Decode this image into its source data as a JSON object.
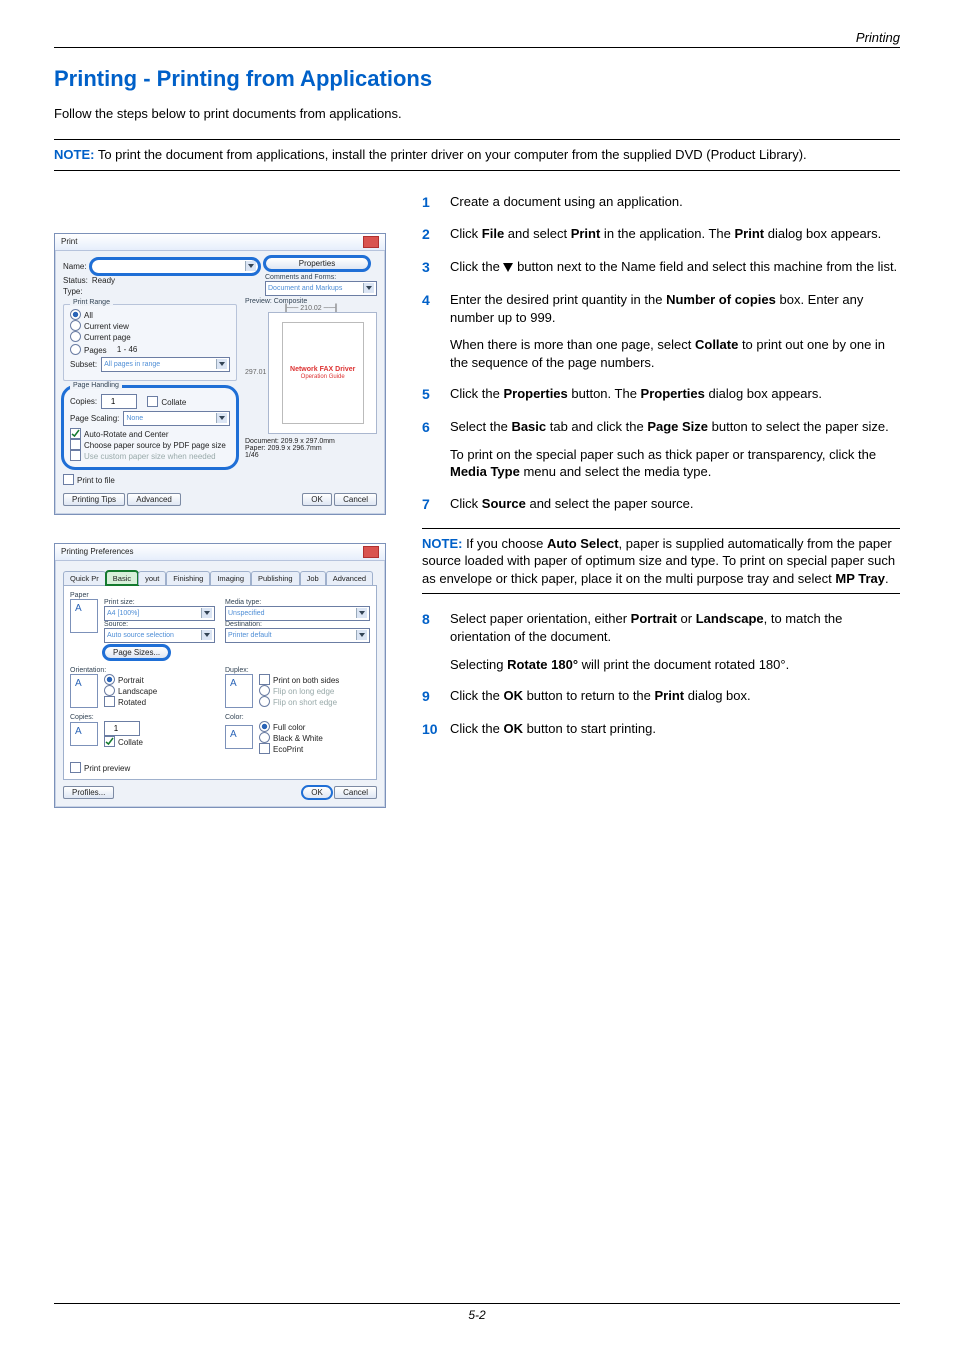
{
  "header": {
    "section": "Printing"
  },
  "title": "Printing - Printing from Applications",
  "intro": "Follow the steps below to print documents from applications.",
  "note1": {
    "label": "NOTE:",
    "text": "To print the document from applications, install the printer driver on your computer from the supplied DVD (Product Library)."
  },
  "steps": [
    {
      "n": "1",
      "paras": [
        "Create a document using an application."
      ]
    },
    {
      "n": "2",
      "paras": [
        "Click <b>File</b> and select <b>Print</b> in the application. The <b>Print</b> dialog box appears."
      ]
    },
    {
      "n": "3",
      "paras": [
        "Click the ▼ button next to the Name field and select this machine from the list."
      ],
      "triangle": true
    },
    {
      "n": "4",
      "paras": [
        "Enter the desired print quantity in the <b>Number of copies</b> box. Enter any number up to 999.",
        "When there is more than one page, select <b>Collate</b> to print out one by one in the sequence of the page numbers."
      ]
    },
    {
      "n": "5",
      "paras": [
        "Click the <b>Properties</b> button. The <b>Properties</b> dialog box appears."
      ]
    },
    {
      "n": "6",
      "paras": [
        "Select the <b>Basic</b> tab and click the <b>Page Size</b> button to select the paper size.",
        "To print on the special paper such as thick paper or transparency, click the <b>Media Type</b> menu and select the media type."
      ]
    },
    {
      "n": "7",
      "paras": [
        "Click <b>Source</b> and select the paper source."
      ]
    }
  ],
  "note2": {
    "label": "NOTE:",
    "text": "If you choose <b>Auto Select</b>, paper is supplied automatically from the paper source loaded with paper of optimum size and type. To print on special paper such as envelope or thick paper, place it on the multi purpose tray and select <b>MP Tray</b>."
  },
  "steps_after": [
    {
      "n": "8",
      "paras": [
        "Select paper orientation, either <b>Portrait</b> or <b>Landscape</b>, to match the orientation of the document.",
        "Selecting <b>Rotate 180°</b> will print the document rotated 180°."
      ]
    },
    {
      "n": "9",
      "paras": [
        "Click the <b>OK</b> button to return to the <b>Print</b> dialog box."
      ]
    },
    {
      "n": "10",
      "paras": [
        "Click the <b>OK</b> button to start printing."
      ]
    }
  ],
  "footer": "5-2",
  "dlg1": {
    "title": "Print",
    "name_label": "Name:",
    "properties_btn": "Properties",
    "status_label": "Status:",
    "status_value": "Ready",
    "type_label": "Type:",
    "comments_label": "Comments and Forms:",
    "comments_value": "Document and Markups",
    "range_title": "Print Range",
    "all": "All",
    "current_view": "Current view",
    "current_page": "Current page",
    "pages_label": "Pages",
    "pages_value": "1 - 46",
    "subset_label": "Subset:",
    "subset_value": "All pages in range",
    "handling_title": "Page Handling",
    "copies_label": "Copies:",
    "copies_value": "1",
    "collate": "Collate",
    "scaling_label": "Page Scaling:",
    "scaling_value": "None",
    "auto_rotate": "Auto-Rotate and Center",
    "choose_source": "Choose paper source by PDF page size",
    "use_custom": "Use custom paper size when needed",
    "print_to_file": "Print to file",
    "preview_label": "Preview: Composite",
    "preview_w": "210.02",
    "preview_h": "297.01",
    "preview_driver": "Network FAX Driver",
    "preview_guide": "Operation Guide",
    "doc_line": "Document: 209.9 x 297.0mm",
    "paper_line": "Paper: 209.9 x 296.7mm",
    "page_of": "1/46",
    "tips_btn": "Printing Tips",
    "adv_btn": "Advanced",
    "ok": "OK",
    "cancel": "Cancel"
  },
  "dlg2": {
    "title": "Printing Preferences",
    "tabs": [
      "Quick Pr",
      "Basic",
      "yout",
      "Finishing",
      "Imaging",
      "Publishing",
      "Job",
      "Advanced"
    ],
    "paper_title": "Paper",
    "print_size_label": "Print size:",
    "print_size_value": "A4  [100%]",
    "source_label": "Source:",
    "source_value": "Auto source selection",
    "page_sizes_btn": "Page Sizes...",
    "media_label": "Media type:",
    "media_value": "Unspecified",
    "dest_label": "Destination:",
    "dest_value": "Printer default",
    "orient_title": "Orientation:",
    "portrait": "Portrait",
    "landscape": "Landscape",
    "rotated": "Rotated",
    "duplex_title": "Duplex:",
    "both_sides": "Print on both sides",
    "long_edge": "Flip on long edge",
    "short_edge": "Flip on short edge",
    "copies_title": "Copies:",
    "copies_value": "1",
    "collate": "Collate",
    "color_title": "Color:",
    "full_color": "Full color",
    "bw": "Black & White",
    "eco": "EcoPrint",
    "print_preview": "Print preview",
    "profiles_btn": "Profiles...",
    "ok": "OK",
    "cancel": "Cancel"
  }
}
